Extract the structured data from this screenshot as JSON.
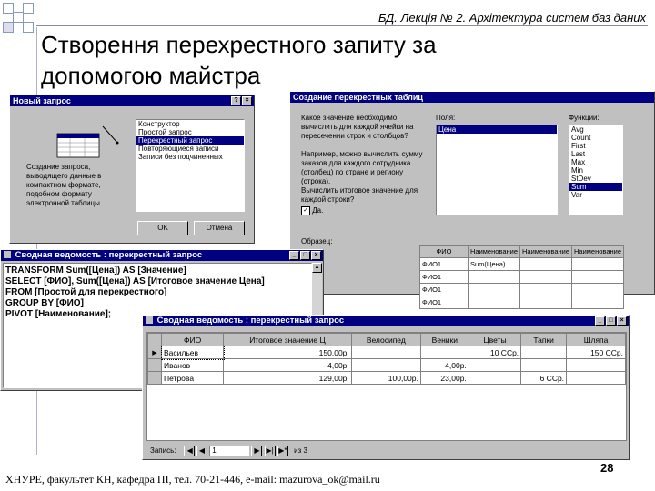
{
  "slide": {
    "header": "БД. Лекція № 2. Архітектура систем баз даних",
    "title_line1": "Створення перехрестного запиту за",
    "title_line2": "допомогою майстра",
    "footer": "ХНУРЕ, факультет КН, кафедра ПІ, тел. 70-21-446, e-mail: mazurova_ok@mail.ru",
    "page_number": "28"
  },
  "new_query_dialog": {
    "title": "Новый запрос",
    "help_btn": "?",
    "close_btn": "×",
    "description": "Создание запроса, выводящего данные в компактном формате, подобном формату электронной таблицы.",
    "items": [
      "Конструктор",
      "Простой запрос",
      "Перекрестный запрос",
      "Повторяющиеся записи",
      "Записи без подчиненных"
    ],
    "selected_index": 2,
    "ok": "OK",
    "cancel": "Отмена"
  },
  "wizard": {
    "title": "Создание перекрестных таблиц",
    "question": "Какое значение необходимо вычислить для каждой ячейки на пересечении строк и столбцов?",
    "example": "Например, можно вычислить сумму заказов для каждого сотрудника (столбец) по стране и региону (строка).",
    "totals_question": "Вычислить итоговое значение для каждой строки?",
    "checkbox_label": "Да.",
    "fields_label": "Поля:",
    "fields": [
      "Цена"
    ],
    "functions_label": "Функции:",
    "functions": [
      "Avg",
      "Count",
      "First",
      "Last",
      "Max",
      "Min",
      "StDev",
      "Sum",
      "Var"
    ],
    "selected_function": "Sum",
    "sample_header": "ФИО",
    "sample_cols": [
      "Наименование",
      "Наименование",
      "Наименование"
    ],
    "sample_rows": [
      "ФИО1",
      "ФИО1",
      "ФИО1",
      "ФИО1"
    ],
    "sample_cell": "Sum(Цена)",
    "sample_label": "Образец:"
  },
  "sql_window": {
    "title": "Сводная ведомость : перекрестный запрос",
    "lines": [
      "TRANSFORM Sum([Цена]) AS [Значение]",
      "SELECT [ФИО], Sum([Цена]) AS [Итоговое значение Цена]",
      "FROM [Простой для перекрестного]",
      "GROUP BY [ФИО]",
      "PIVOT [Наименование];"
    ]
  },
  "result_window": {
    "title": "Сводная ведомость : перекрестный запрос",
    "columns": [
      "ФИО",
      "Итоговое значение Ц",
      "Велосипед",
      "Веники",
      "Цветы",
      "Тапки",
      "Шляпа"
    ],
    "rows": [
      [
        "Васильев",
        "150,00р.",
        "",
        "",
        "10 ССр.",
        "",
        "150 ССр."
      ],
      [
        "Иванов",
        "4,00р.",
        "",
        "4,00р.",
        "",
        "",
        ""
      ],
      [
        "Петрова",
        "129,00р.",
        "100,00р.",
        "23,00р.",
        "",
        "6 ССр.",
        ""
      ]
    ],
    "record_label": "Запись:",
    "record_current": "1",
    "record_of": "из 3"
  }
}
